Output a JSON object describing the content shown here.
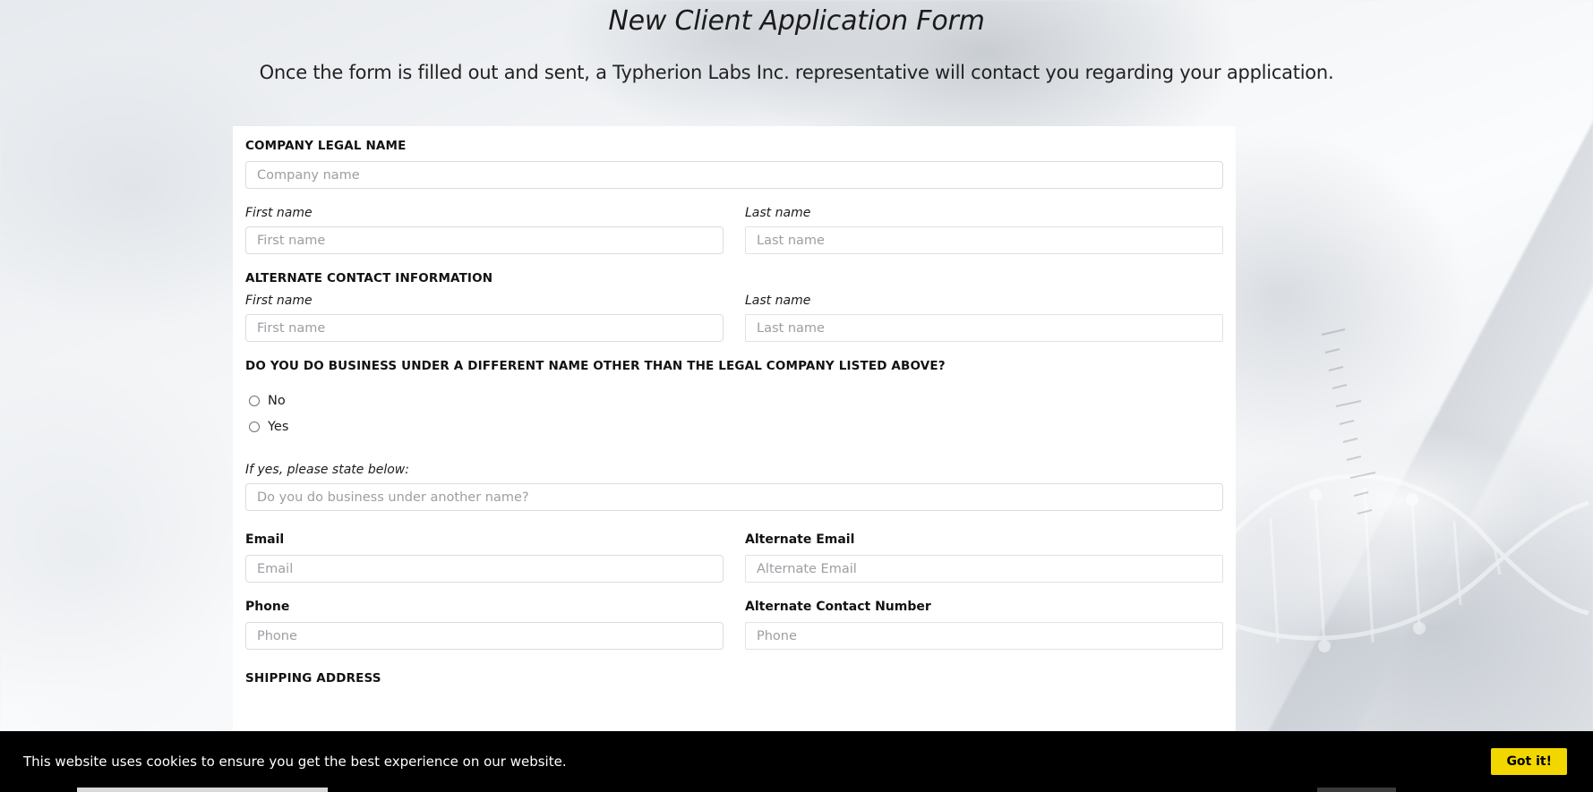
{
  "header": {
    "title": "New Client Application Form",
    "subtitle": "Once the form is filled out and sent, a Typherion Labs Inc. representative will contact you regarding your application."
  },
  "form": {
    "company_section_heading": "COMPANY LEGAL NAME",
    "company_name_placeholder": "Company name",
    "primary_contact": {
      "first_name_label": "First name",
      "first_name_placeholder": "First name",
      "last_name_label": "Last name",
      "last_name_placeholder": "Last name"
    },
    "alternate_section_heading": "ALTERNATE CONTACT INFORMATION",
    "alternate_contact": {
      "first_name_label": "First name",
      "first_name_placeholder": "First name",
      "last_name_label": "Last name",
      "last_name_placeholder": "Last name"
    },
    "dba_question": "DO YOU DO BUSINESS UNDER A DIFFERENT NAME OTHER THAN THE LEGAL COMPANY LISTED ABOVE?",
    "dba_options": [
      {
        "label": "No",
        "selected": false
      },
      {
        "label": "Yes",
        "selected": false
      }
    ],
    "dba_followup_label": "If yes, please state below:",
    "dba_followup_placeholder": "Do you do business under another name?",
    "email": {
      "label": "Email",
      "placeholder": "Email"
    },
    "alternate_email": {
      "label": "Alternate Email",
      "placeholder": "Alternate Email"
    },
    "phone": {
      "label": "Phone",
      "placeholder": "Phone"
    },
    "alternate_phone": {
      "label": "Alternate Contact Number",
      "placeholder": "Phone"
    },
    "shipping_section_heading": "SHIPPING ADDRESS"
  },
  "cookie_banner": {
    "message": "This website uses cookies to ensure you get the best experience on our website.",
    "accept_label": "Got it!",
    "accent_color": "#f2d600",
    "background_color": "#000000"
  }
}
